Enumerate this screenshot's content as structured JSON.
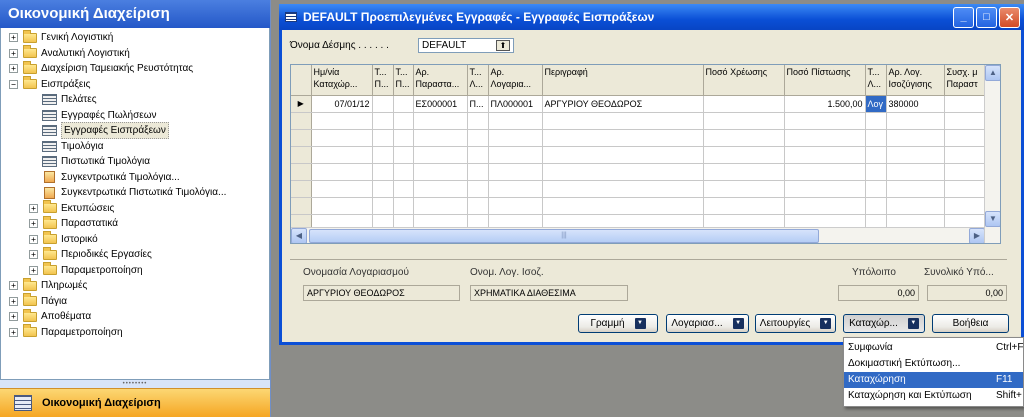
{
  "nav": {
    "title": "Οικονομική Διαχείριση",
    "tree": [
      {
        "label": "Γενική Λογιστική",
        "type": "folder",
        "expander": "+",
        "level": 0
      },
      {
        "label": "Αναλυτική Λογιστική",
        "type": "folder",
        "expander": "+",
        "level": 0
      },
      {
        "label": "Διαχείριση Ταμειακής Ρευστότητας",
        "type": "folder",
        "expander": "+",
        "level": 0
      },
      {
        "label": "Εισπράξεις",
        "type": "folder-open",
        "expander": "−",
        "level": 0
      },
      {
        "label": "Πελάτες",
        "type": "form",
        "level": 1
      },
      {
        "label": "Εγγραφές Πωλήσεων",
        "type": "form",
        "level": 1
      },
      {
        "label": "Εγγραφές Εισπράξεων",
        "type": "form",
        "level": 1,
        "selected": true
      },
      {
        "label": "Τιμολόγια",
        "type": "form",
        "level": 1
      },
      {
        "label": "Πιστωτικά Τιμολόγια",
        "type": "form",
        "level": 1
      },
      {
        "label": "Συγκεντρωτικά Τιμολόγια...",
        "type": "report",
        "level": 1
      },
      {
        "label": "Συγκεντρωτικά Πιστωτικά Τιμολόγια...",
        "type": "report",
        "level": 1
      },
      {
        "label": "Εκτυπώσεις",
        "type": "folder",
        "expander": "+",
        "level": 1
      },
      {
        "label": "Παραστατικά",
        "type": "folder",
        "expander": "+",
        "level": 1
      },
      {
        "label": "Ιστορικό",
        "type": "folder",
        "expander": "+",
        "level": 1
      },
      {
        "label": "Περιοδικές Εργασίες",
        "type": "folder",
        "expander": "+",
        "level": 1
      },
      {
        "label": "Παραμετροποίηση",
        "type": "folder",
        "expander": "+",
        "level": 1
      },
      {
        "label": "Πληρωμές",
        "type": "folder",
        "expander": "+",
        "level": 0
      },
      {
        "label": "Πάγια",
        "type": "folder",
        "expander": "+",
        "level": 0
      },
      {
        "label": "Αποθέματα",
        "type": "folder",
        "expander": "+",
        "level": 0
      },
      {
        "label": "Παραμετροποίηση",
        "type": "folder",
        "expander": "+",
        "level": 0
      }
    ],
    "splitter": "••••••••",
    "bottom_label": "Οικονομική Διαχείριση"
  },
  "window": {
    "title": "DEFAULT Προεπιλεγμένες Εγγραφές - Εγγραφές Εισπράξεων",
    "controls": {
      "minimize": "_",
      "maximize": "□",
      "close": "✕"
    },
    "batch_label": "Όνομα Δέσμης . . . . . .",
    "batch_value": "DEFAULT",
    "lookup_glyph": "⬆"
  },
  "grid": {
    "columns": [
      {
        "label": "",
        "w": 20
      },
      {
        "label": "Ημ/νία\nΚαταχώρ...",
        "w": 61
      },
      {
        "label": "Τ...\nΠ...",
        "w": 21
      },
      {
        "label": "Τ...\nΠ...",
        "w": 20
      },
      {
        "label": "Αρ.\nΠαραστα...",
        "w": 54
      },
      {
        "label": "Τ...\nΛ...",
        "w": 21
      },
      {
        "label": "Αρ.\nΛογαρια...",
        "w": 54
      },
      {
        "label": "Περιγραφή",
        "w": 161
      },
      {
        "label": "Ποσό Χρέωσης",
        "w": 81
      },
      {
        "label": "Ποσό Πίστωσης",
        "w": 81
      },
      {
        "label": "Τ...\nΛ...",
        "w": 21
      },
      {
        "label": "Αρ. Λογ.\nΙσοζύγισης",
        "w": 58
      },
      {
        "label": "Συσχ. μ\nΠαραστ",
        "w": 42
      }
    ],
    "rows": [
      [
        "▶",
        "07/01/12",
        "",
        "",
        "ΕΣ000001",
        "Π...",
        "ΠΛ000001",
        "ΑΡΓΥΡΙΟΥ ΘΕΟΔΩΡΟΣ",
        "",
        "1.500,00",
        "Λογ",
        "380000",
        ""
      ],
      [
        "",
        "",
        "",
        "",
        "",
        "",
        "",
        "",
        "",
        "",
        "",
        "",
        ""
      ],
      [
        "",
        "",
        "",
        "",
        "",
        "",
        "",
        "",
        "",
        "",
        "",
        "",
        ""
      ],
      [
        "",
        "",
        "",
        "",
        "",
        "",
        "",
        "",
        "",
        "",
        "",
        "",
        ""
      ],
      [
        "",
        "",
        "",
        "",
        "",
        "",
        "",
        "",
        "",
        "",
        "",
        "",
        ""
      ],
      [
        "",
        "",
        "",
        "",
        "",
        "",
        "",
        "",
        "",
        "",
        "",
        "",
        ""
      ],
      [
        "",
        "",
        "",
        "",
        "",
        "",
        "",
        "",
        "",
        "",
        "",
        "",
        ""
      ],
      [
        "",
        "",
        "",
        "",
        "",
        "",
        "",
        "",
        "",
        "",
        "",
        "",
        ""
      ]
    ],
    "scroll_left": "◀",
    "scroll_right": "▶",
    "scroll_up": "▲",
    "scroll_down": "▼",
    "thumb_grip": "|||"
  },
  "footer": {
    "account_name_label": "Ονομασία Λογαριασμού",
    "account_name_value": "ΑΡΓΥΡΙΟΥ ΘΕΟΔΩΡΟΣ",
    "balancing_label": "Ονομ. Λογ. Ισοζ.",
    "balancing_value": "ΧΡΗΜΑΤΙΚΑ ΔΙΑΘΕΣΙΜΑ",
    "balance_label": "Υπόλοιπο",
    "balance_value": "0,00",
    "total_label": "Συνολικό Υπό...",
    "total_value": "0,00"
  },
  "buttons": {
    "line": "Γραμμή",
    "account": "Λογαριασ...",
    "functions": "Λειτουργίες",
    "posting": "Καταχώρ...",
    "help": "Βοήθεια",
    "arrow_glyph": "▼"
  },
  "posting_menu": [
    {
      "label": "Συμφωνία",
      "shortcut": "Ctrl+F"
    },
    {
      "label": "Δοκιμαστική Εκτύπωση...",
      "shortcut": ""
    },
    {
      "label": "Καταχώρηση",
      "shortcut": "F11",
      "highlighted": true
    },
    {
      "label": "Καταχώρηση και Εκτύπωση",
      "shortcut": "Shift+"
    }
  ],
  "colors": {
    "title_blue": "#0a4fd6",
    "highlight": "#316ac5",
    "nav_bottom": "#f5a623"
  }
}
